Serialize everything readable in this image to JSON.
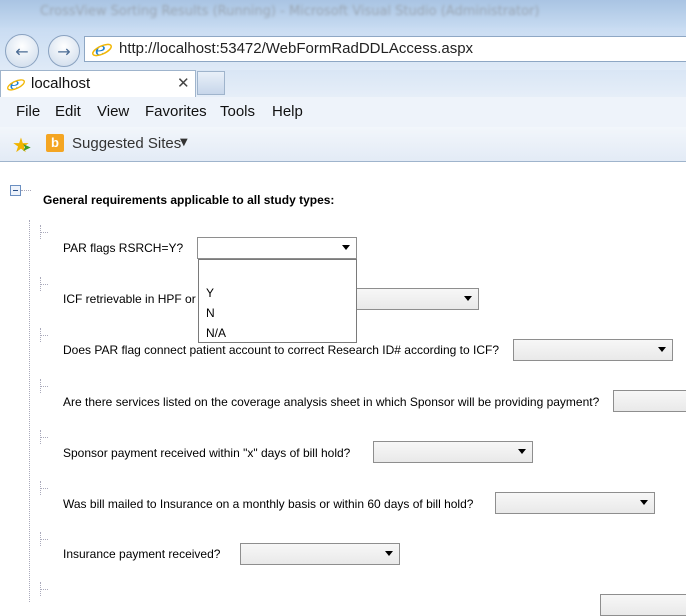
{
  "window": {
    "title": "CrossView Sorting Results (Running) - Microsoft Visual Studio (Administrator)"
  },
  "browser": {
    "url": "http://localhost:53472/WebFormRadDDLAccess.aspx",
    "tab_label": "localhost",
    "menu": [
      "File",
      "Edit",
      "View",
      "Favorites",
      "Tools",
      "Help"
    ],
    "favorites_label": "Suggested Sites"
  },
  "page": {
    "heading": "General requirements applicable to all study types:",
    "questions": [
      {
        "label": "PAR flags RSRCH=Y?",
        "value": ""
      },
      {
        "label": "ICF retrievable in HPF or f",
        "value": ""
      },
      {
        "label": "Does PAR flag connect patient account to correct Research ID# according to ICF?",
        "value": ""
      },
      {
        "label": "Are there services listed on the coverage analysis sheet in which Sponsor will be providing payment?",
        "value": ""
      },
      {
        "label": "Sponsor payment received within \"x\" days of bill hold?",
        "value": ""
      },
      {
        "label": "Was bill mailed to Insurance on a monthly basis or within 60 days of bill hold?",
        "value": ""
      },
      {
        "label": "Insurance payment received?",
        "value": ""
      }
    ],
    "open_dropdown_options": [
      "",
      "Y",
      "N",
      "N/A"
    ]
  }
}
